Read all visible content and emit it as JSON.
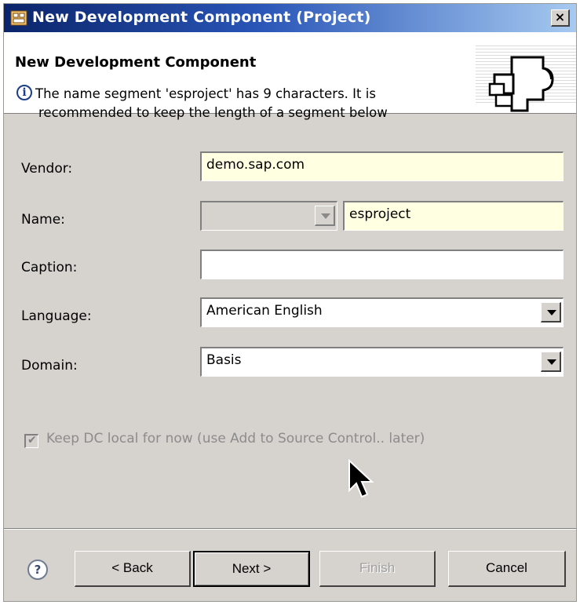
{
  "window": {
    "title": "New Development Component (Project)",
    "close_label": "×"
  },
  "header": {
    "title": "New Development Component",
    "message_line1": "The name segment 'esproject' has 9 characters. It is",
    "message_line2": "recommended to keep the length of a segment below"
  },
  "form": {
    "vendor": {
      "label": "Vendor:",
      "value": "demo.sap.com"
    },
    "name": {
      "label": "Name:",
      "prefix_value": "",
      "value": "esproject"
    },
    "caption": {
      "label": "Caption:",
      "value": ""
    },
    "language": {
      "label": "Language:",
      "value": "American English"
    },
    "domain": {
      "label": "Domain:",
      "value": "Basis"
    },
    "keep_local": {
      "label": "Keep DC local for now (use Add to Source Control.. later)",
      "checked": true,
      "enabled": false
    }
  },
  "buttons": {
    "help": "?",
    "back": "< Back",
    "next": "Next >",
    "finish": "Finish",
    "cancel": "Cancel"
  },
  "icons": {
    "title": "component-icon",
    "info": "info-icon",
    "banner": "puzzle-component-icon",
    "help": "help-icon",
    "cursor": "mouse-pointer-icon"
  },
  "colors": {
    "title_bar_start": "#0a246a",
    "title_bar_end": "#a6caf0",
    "dialog_bg": "#d6d3ce",
    "required_field_bg": "#ffffe1"
  }
}
